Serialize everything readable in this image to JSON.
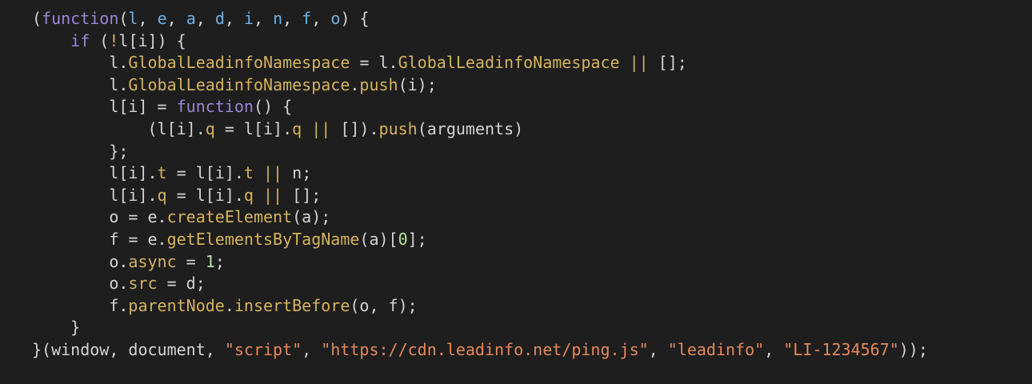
{
  "colors": {
    "background": "#1e1e1e",
    "text": "#d4d4d4",
    "keyword": "#9d86d8",
    "property": "#d6b35c",
    "string": "#e5895b",
    "number": "#b9e2a0",
    "param": "#6cb1e8"
  },
  "lines": [
    [
      [
        "def",
        "("
      ],
      [
        "kw",
        "function"
      ],
      [
        "def",
        "("
      ],
      [
        "arg",
        "l"
      ],
      [
        "def",
        ", "
      ],
      [
        "arg",
        "e"
      ],
      [
        "def",
        ", "
      ],
      [
        "arg",
        "a"
      ],
      [
        "def",
        ", "
      ],
      [
        "arg",
        "d"
      ],
      [
        "def",
        ", "
      ],
      [
        "arg",
        "i"
      ],
      [
        "def",
        ", "
      ],
      [
        "arg",
        "n"
      ],
      [
        "def",
        ", "
      ],
      [
        "arg",
        "f"
      ],
      [
        "def",
        ", "
      ],
      [
        "arg",
        "o"
      ],
      [
        "def",
        ") {"
      ]
    ],
    [
      [
        "def",
        "    "
      ],
      [
        "kw",
        "if"
      ],
      [
        "def",
        " ("
      ],
      [
        "op",
        "!"
      ],
      [
        "def",
        "l[i]) {"
      ]
    ],
    [
      [
        "def",
        "        l."
      ],
      [
        "prop",
        "GlobalLeadinfoNamespace"
      ],
      [
        "def",
        " = l."
      ],
      [
        "prop",
        "GlobalLeadinfoNamespace"
      ],
      [
        "def",
        " "
      ],
      [
        "op",
        "||"
      ],
      [
        "def",
        " [];"
      ]
    ],
    [
      [
        "def",
        "        l."
      ],
      [
        "prop",
        "GlobalLeadinfoNamespace"
      ],
      [
        "def",
        "."
      ],
      [
        "fn",
        "push"
      ],
      [
        "def",
        "(i);"
      ]
    ],
    [
      [
        "def",
        "        l[i] = "
      ],
      [
        "kw",
        "function"
      ],
      [
        "def",
        "() {"
      ]
    ],
    [
      [
        "def",
        "            (l[i]."
      ],
      [
        "prop",
        "q"
      ],
      [
        "def",
        " = l[i]."
      ],
      [
        "prop",
        "q"
      ],
      [
        "def",
        " "
      ],
      [
        "op",
        "||"
      ],
      [
        "def",
        " [])."
      ],
      [
        "fn",
        "push"
      ],
      [
        "def",
        "(arguments)"
      ]
    ],
    [
      [
        "def",
        "        };"
      ]
    ],
    [
      [
        "def",
        "        l[i]."
      ],
      [
        "prop",
        "t"
      ],
      [
        "def",
        " = l[i]."
      ],
      [
        "prop",
        "t"
      ],
      [
        "def",
        " "
      ],
      [
        "op",
        "||"
      ],
      [
        "def",
        " n;"
      ]
    ],
    [
      [
        "def",
        "        l[i]."
      ],
      [
        "prop",
        "q"
      ],
      [
        "def",
        " = l[i]."
      ],
      [
        "prop",
        "q"
      ],
      [
        "def",
        " "
      ],
      [
        "op",
        "||"
      ],
      [
        "def",
        " [];"
      ]
    ],
    [
      [
        "def",
        "        o = e."
      ],
      [
        "fn",
        "createElement"
      ],
      [
        "def",
        "(a);"
      ]
    ],
    [
      [
        "def",
        "        f = e."
      ],
      [
        "fn",
        "getElementsByTagName"
      ],
      [
        "def",
        "(a)["
      ],
      [
        "num",
        "0"
      ],
      [
        "def",
        "];"
      ]
    ],
    [
      [
        "def",
        "        o."
      ],
      [
        "prop",
        "async"
      ],
      [
        "def",
        " = "
      ],
      [
        "num",
        "1"
      ],
      [
        "def",
        ";"
      ]
    ],
    [
      [
        "def",
        "        o."
      ],
      [
        "prop",
        "src"
      ],
      [
        "def",
        " = d;"
      ]
    ],
    [
      [
        "def",
        "        f."
      ],
      [
        "prop",
        "parentNode"
      ],
      [
        "def",
        "."
      ],
      [
        "fn",
        "insertBefore"
      ],
      [
        "def",
        "(o, f);"
      ]
    ],
    [
      [
        "def",
        "    }"
      ]
    ],
    [
      [
        "def",
        "}(window, document, "
      ],
      [
        "str",
        "\"script\""
      ],
      [
        "def",
        ", "
      ],
      [
        "str",
        "\"https://cdn.leadinfo.net/ping.js\""
      ],
      [
        "def",
        ", "
      ],
      [
        "str",
        "\"leadinfo\""
      ],
      [
        "def",
        ", "
      ],
      [
        "str",
        "\"LI-1234567\""
      ],
      [
        "def",
        "));"
      ]
    ]
  ]
}
